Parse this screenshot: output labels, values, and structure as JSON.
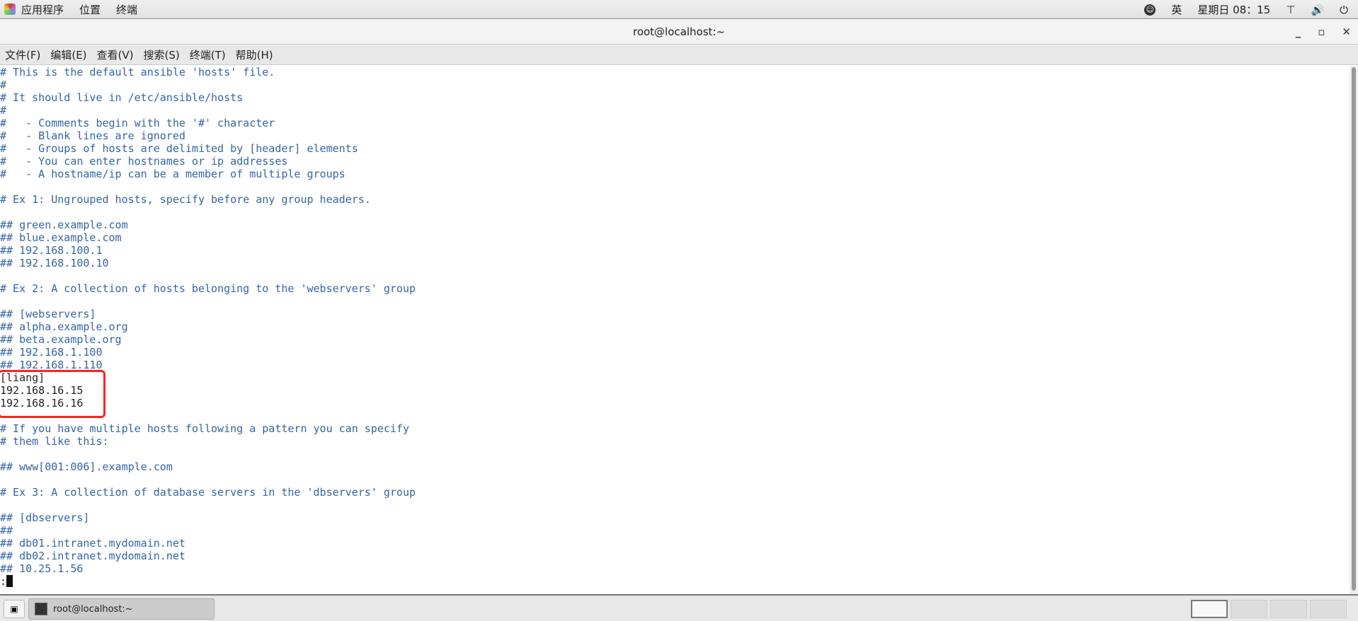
{
  "top_panel": {
    "menus": [
      "应用程序",
      "位置",
      "终端"
    ],
    "input_method": "英",
    "clock": "星期日 08：15",
    "icons": [
      "accessibility-icon",
      "network-icon",
      "volume-icon",
      "power-icon"
    ]
  },
  "window": {
    "title": "root@localhost:~"
  },
  "menubar": [
    "文件(F)",
    "编辑(E)",
    "查看(V)",
    "搜索(S)",
    "终端(T)",
    "帮助(H)"
  ],
  "terminal": {
    "lines": [
      "# This is the default ansible 'hosts' file.",
      "#",
      "# It should live in /etc/ansible/hosts",
      "#",
      "#   - Comments begin with the '#' character",
      "#   - Blank lines are ignored",
      "#   - Groups of hosts are delimited by [header] elements",
      "#   - You can enter hostnames or ip addresses",
      "#   - A hostname/ip can be a member of multiple groups",
      "",
      "# Ex 1: Ungrouped hosts, specify before any group headers.",
      "",
      "## green.example.com",
      "## blue.example.com",
      "## 192.168.100.1",
      "## 192.168.100.10",
      "",
      "# Ex 2: A collection of hosts belonging to the 'webservers' group",
      "",
      "## [webservers]",
      "## alpha.example.org",
      "## beta.example.org",
      "## 192.168.1.100",
      "## 192.168.1.110",
      "[liang]",
      "192.168.16.15",
      "192.168.16.16",
      "",
      "# If you have multiple hosts following a pattern you can specify",
      "# them like this:",
      "",
      "## www[001:006].example.com",
      "",
      "# Ex 3: A collection of database servers in the 'dbservers' group",
      "",
      "## [dbservers]",
      "##",
      "## db01.intranet.mydomain.net",
      "## db02.intranet.mydomain.net",
      "## 10.25.1.56"
    ],
    "prompt": ":",
    "highlight_color": "#ff2222"
  },
  "taskbar": {
    "task_label": "root@localhost:~"
  }
}
